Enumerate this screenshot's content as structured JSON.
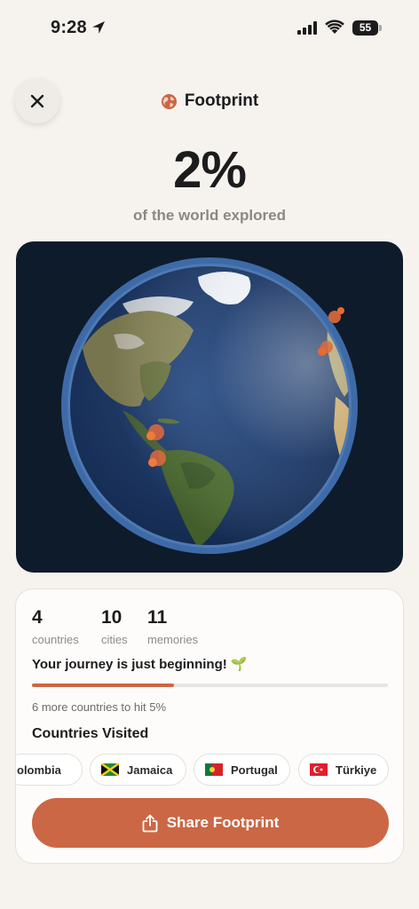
{
  "status": {
    "time": "9:28",
    "battery": "55"
  },
  "header": {
    "title": "Footprint"
  },
  "summary": {
    "percent": "2%",
    "caption": "of the world explored"
  },
  "stats": [
    {
      "value": "4",
      "label": "countries"
    },
    {
      "value": "10",
      "label": "cities"
    },
    {
      "value": "11",
      "label": "memories"
    }
  ],
  "journey": {
    "message": "Your journey is just beginning! 🌱",
    "progress_fraction": 0.4,
    "note": "6 more countries to hit 5%"
  },
  "countries": {
    "title": "Countries Visited",
    "items": [
      {
        "name": "olombia",
        "flag": "colombia"
      },
      {
        "name": "Jamaica",
        "flag": "jamaica"
      },
      {
        "name": "Portugal",
        "flag": "portugal"
      },
      {
        "name": "Türkiye",
        "flag": "turkey"
      }
    ]
  },
  "share": {
    "label": "Share Footprint"
  },
  "colors": {
    "accent": "#cb6744",
    "background": "#f6f3ee",
    "globe_bg": "#0e1b2b"
  }
}
